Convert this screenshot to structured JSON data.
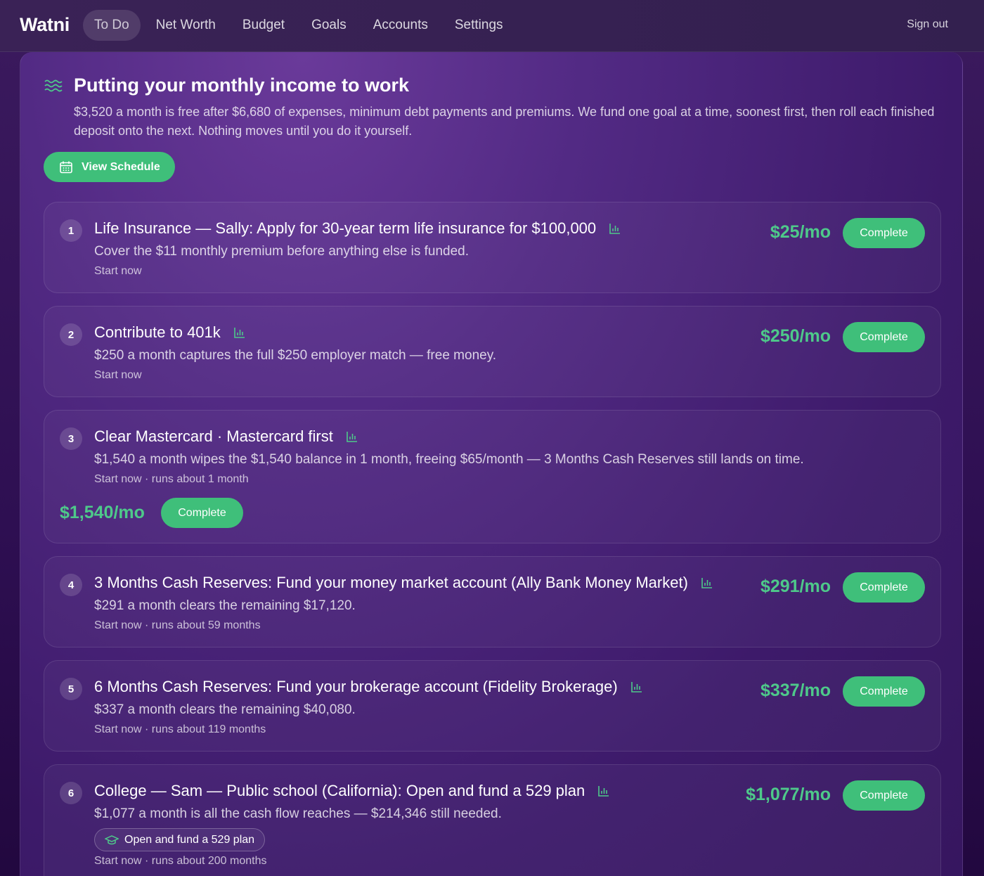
{
  "nav": {
    "brand": "Watni",
    "links": [
      "To Do",
      "Net Worth",
      "Budget",
      "Goals",
      "Accounts",
      "Settings"
    ],
    "sign_out": "Sign out",
    "active": "To Do"
  },
  "hero": {
    "icon": "waves-icon",
    "title": "Putting your monthly income to work",
    "description": "$3,520 a month is free after $6,680 of expenses, minimum debt payments and premiums. We fund one goal at a time, soonest first, then roll each finished deposit onto the next. Nothing moves until you do it yourself.",
    "schedule_button": "View Schedule"
  },
  "colors": {
    "accent": "#3fbf7a",
    "amount": "#4ec98a",
    "background": "#3b1a5e"
  },
  "tasks": [
    {
      "number": "1",
      "title": "Life Insurance — Sally: Apply for 30-year term life insurance for $100,000",
      "description": "Cover the $11 monthly premium before anything else is funded.",
      "meta": "Start now",
      "amount": "$25/mo",
      "action": "Complete"
    },
    {
      "number": "2",
      "title": "Contribute to 401k",
      "description": "$250 a month captures the full $250 employer match — free money.",
      "meta": "Start now",
      "amount": "$250/mo",
      "action": "Complete"
    },
    {
      "number": "3",
      "title": "Clear Mastercard · Mastercard first",
      "description": "$1,540 a month wipes the $1,540 balance in 1 month, freeing $65/month — 3 Months Cash Reserves still lands on time.",
      "meta": "Start now · runs about 1 month",
      "amount": "$1,540/mo",
      "action": "Complete"
    },
    {
      "number": "4",
      "title": "3 Months Cash Reserves: Fund your money market account (Ally Bank Money Market)",
      "description": "$291 a month clears the remaining $17,120.",
      "meta": "Start now · runs about 59 months",
      "amount": "$291/mo",
      "action": "Complete"
    },
    {
      "number": "5",
      "title": "6 Months Cash Reserves: Fund your brokerage account (Fidelity Brokerage)",
      "description": "$337 a month clears the remaining $40,080.",
      "meta": "Start now · runs about 119 months",
      "amount": "$337/mo",
      "action": "Complete"
    },
    {
      "number": "6",
      "title": "College — Sam — Public school (California): Open and fund a 529 plan",
      "description": "$1,077 a month is all the cash flow reaches — $214,346 still needed.",
      "pill": "Open and fund a 529 plan",
      "meta": "Start now · runs about 200 months",
      "amount": "$1,077/mo",
      "action": "Complete"
    }
  ]
}
